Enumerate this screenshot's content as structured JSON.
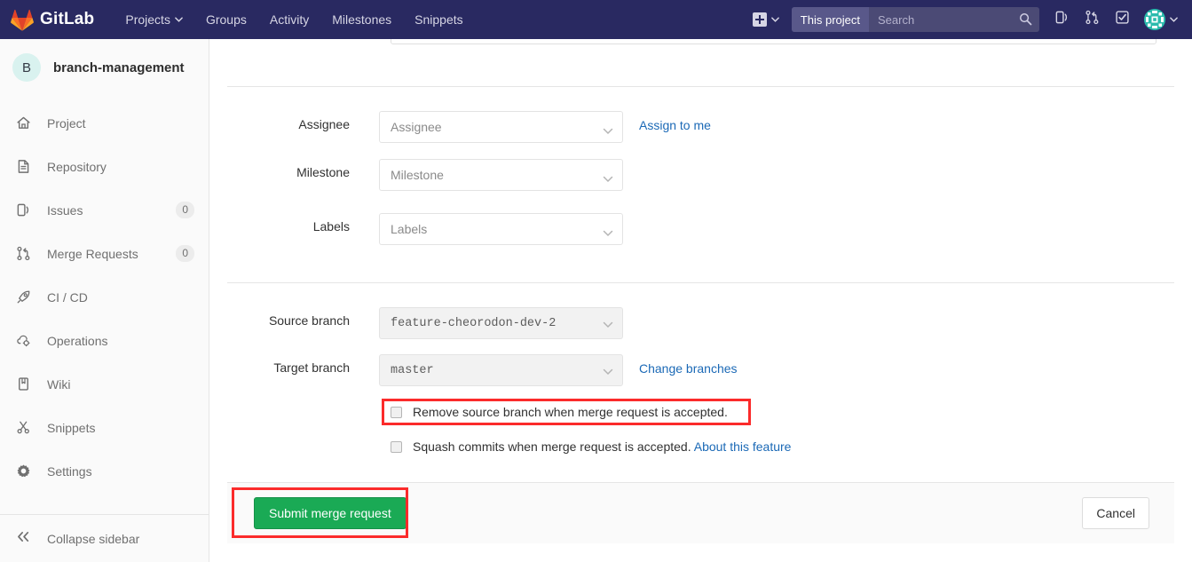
{
  "navbar": {
    "brand": "GitLab",
    "logo_icon": "gitlab-fox-logo",
    "links": [
      {
        "label": "Projects",
        "icon": "chevron-down-icon",
        "has_caret": true
      },
      {
        "label": "Groups",
        "has_caret": false
      },
      {
        "label": "Activity",
        "has_caret": false
      },
      {
        "label": "Milestones",
        "has_caret": false
      },
      {
        "label": "Snippets",
        "has_caret": false
      }
    ],
    "new_button": {
      "icon": "plus-square-icon",
      "caret_icon": "chevron-down-icon"
    },
    "search": {
      "scope": "This project",
      "placeholder": "Search",
      "value": "",
      "icon": "search-icon"
    },
    "icons": [
      {
        "name": "issues-icon"
      },
      {
        "name": "merge-requests-icon"
      },
      {
        "name": "todos-check-icon"
      }
    ],
    "user": {
      "avatar_icon": "user-avatar-identicon",
      "caret_icon": "chevron-down-icon"
    },
    "colors": {
      "background": "#292961",
      "search_bg": "#4b4a75",
      "scope_bg": "#59588a"
    }
  },
  "sidebar": {
    "project": {
      "initial": "B",
      "name": "branch-management",
      "avatar_bg": "#d9f2ef"
    },
    "items": [
      {
        "label": "Project",
        "icon": "home-icon",
        "badge": ""
      },
      {
        "label": "Repository",
        "icon": "document-icon",
        "badge": ""
      },
      {
        "label": "Issues",
        "icon": "issues-icon",
        "badge": "0"
      },
      {
        "label": "Merge Requests",
        "icon": "merge-requests-icon",
        "badge": "0"
      },
      {
        "label": "CI / CD",
        "icon": "rocket-icon",
        "badge": ""
      },
      {
        "label": "Operations",
        "icon": "operations-cloud-gear-icon",
        "badge": ""
      },
      {
        "label": "Wiki",
        "icon": "book-icon",
        "badge": ""
      },
      {
        "label": "Snippets",
        "icon": "scissors-icon",
        "badge": ""
      },
      {
        "label": "Settings",
        "icon": "gear-icon",
        "badge": ""
      }
    ],
    "collapse": {
      "label": "Collapse sidebar",
      "icon": "double-chevron-left-icon"
    }
  },
  "form": {
    "fields": [
      {
        "label": "Assignee",
        "name": "assignee",
        "value": "Assignee",
        "is_placeholder": true,
        "disabled": false,
        "caret_icon": "chevron-down-icon",
        "link": "Assign to me"
      },
      {
        "label": "Milestone",
        "name": "milestone",
        "value": "Milestone",
        "is_placeholder": true,
        "disabled": false,
        "caret_icon": "chevron-down-icon",
        "link": ""
      },
      {
        "label": "Labels",
        "name": "labels",
        "value": "Labels",
        "is_placeholder": true,
        "disabled": false,
        "caret_icon": "chevron-down-icon",
        "link": ""
      }
    ],
    "branches": [
      {
        "label": "Source branch",
        "name": "source-branch",
        "value": "feature-cheorodon-dev-2",
        "disabled": true,
        "caret_icon": "chevron-down-icon",
        "link": ""
      },
      {
        "label": "Target branch",
        "name": "target-branch",
        "value": "master",
        "disabled": true,
        "caret_icon": "chevron-down-icon",
        "link": "Change branches"
      }
    ],
    "checkboxes": [
      {
        "name": "remove-source-branch",
        "label": "Remove source branch when merge request is accepted.",
        "checked": false,
        "link": "",
        "highlighted": true
      },
      {
        "name": "squash-commits",
        "label": "Squash commits when merge request is accepted.",
        "checked": false,
        "link": "About this feature",
        "highlighted": false
      }
    ],
    "actions": {
      "submit_label": "Submit merge request",
      "cancel_label": "Cancel",
      "submit_color": "#1aaa55",
      "highlight_color": "#fb2b2b"
    }
  }
}
